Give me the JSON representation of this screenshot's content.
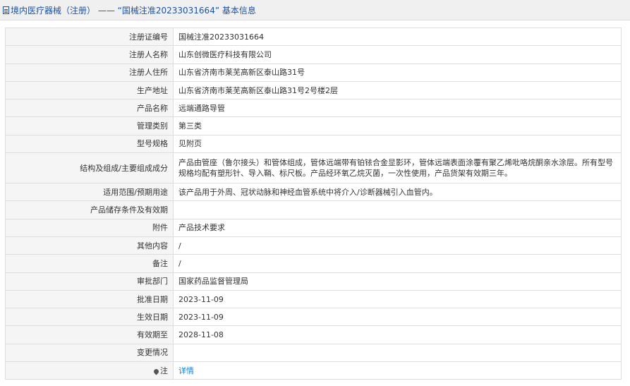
{
  "header": {
    "title": "境内医疗器械（注册） —— “国械注准20233031664” 基本信息"
  },
  "rows": [
    {
      "label": "注册证编号",
      "value": "国械注准20233031664"
    },
    {
      "label": "注册人名称",
      "value": "山东创微医疗科技有限公司"
    },
    {
      "label": "注册人住所",
      "value": "山东省济南市莱芜高新区泰山路31号"
    },
    {
      "label": "生产地址",
      "value": "山东省济南市莱芜高新区泰山路31号2号楼2层"
    },
    {
      "label": "产品名称",
      "value": "远端通路导管"
    },
    {
      "label": "管理类别",
      "value": "第三类"
    },
    {
      "label": "型号规格",
      "value": "见附页"
    },
    {
      "label": "结构及组成/主要组成成分",
      "value": "产品由管座（鲁尔接头）和管体组成，管体远端带有铂铱合金显影环，管体远端表面涂覆有聚乙烯吡咯烷酮亲水涂层。所有型号规格均配有塑形针、导入鞘、标尺板。产品经环氧乙烷灭菌，一次性使用，产品货架有效期三年。"
    },
    {
      "label": "适用范围/预期用途",
      "value": "该产品用于外周、冠状动脉和神经血管系统中将介入/诊断器械引入血管内。"
    },
    {
      "label": "产品储存条件及有效期",
      "value": ""
    },
    {
      "label": "附件",
      "value": "产品技术要求"
    },
    {
      "label": "其他内容",
      "value": "/"
    },
    {
      "label": "备注",
      "value": "/"
    },
    {
      "label": "审批部门",
      "value": "国家药品监督管理局"
    },
    {
      "label": "批准日期",
      "value": "2023-11-09"
    },
    {
      "label": "生效日期",
      "value": "2023-11-09"
    },
    {
      "label": "有效期至",
      "value": "2028-11-08"
    },
    {
      "label": "变更情况",
      "value": ""
    },
    {
      "label": "注",
      "value": "详情"
    }
  ]
}
